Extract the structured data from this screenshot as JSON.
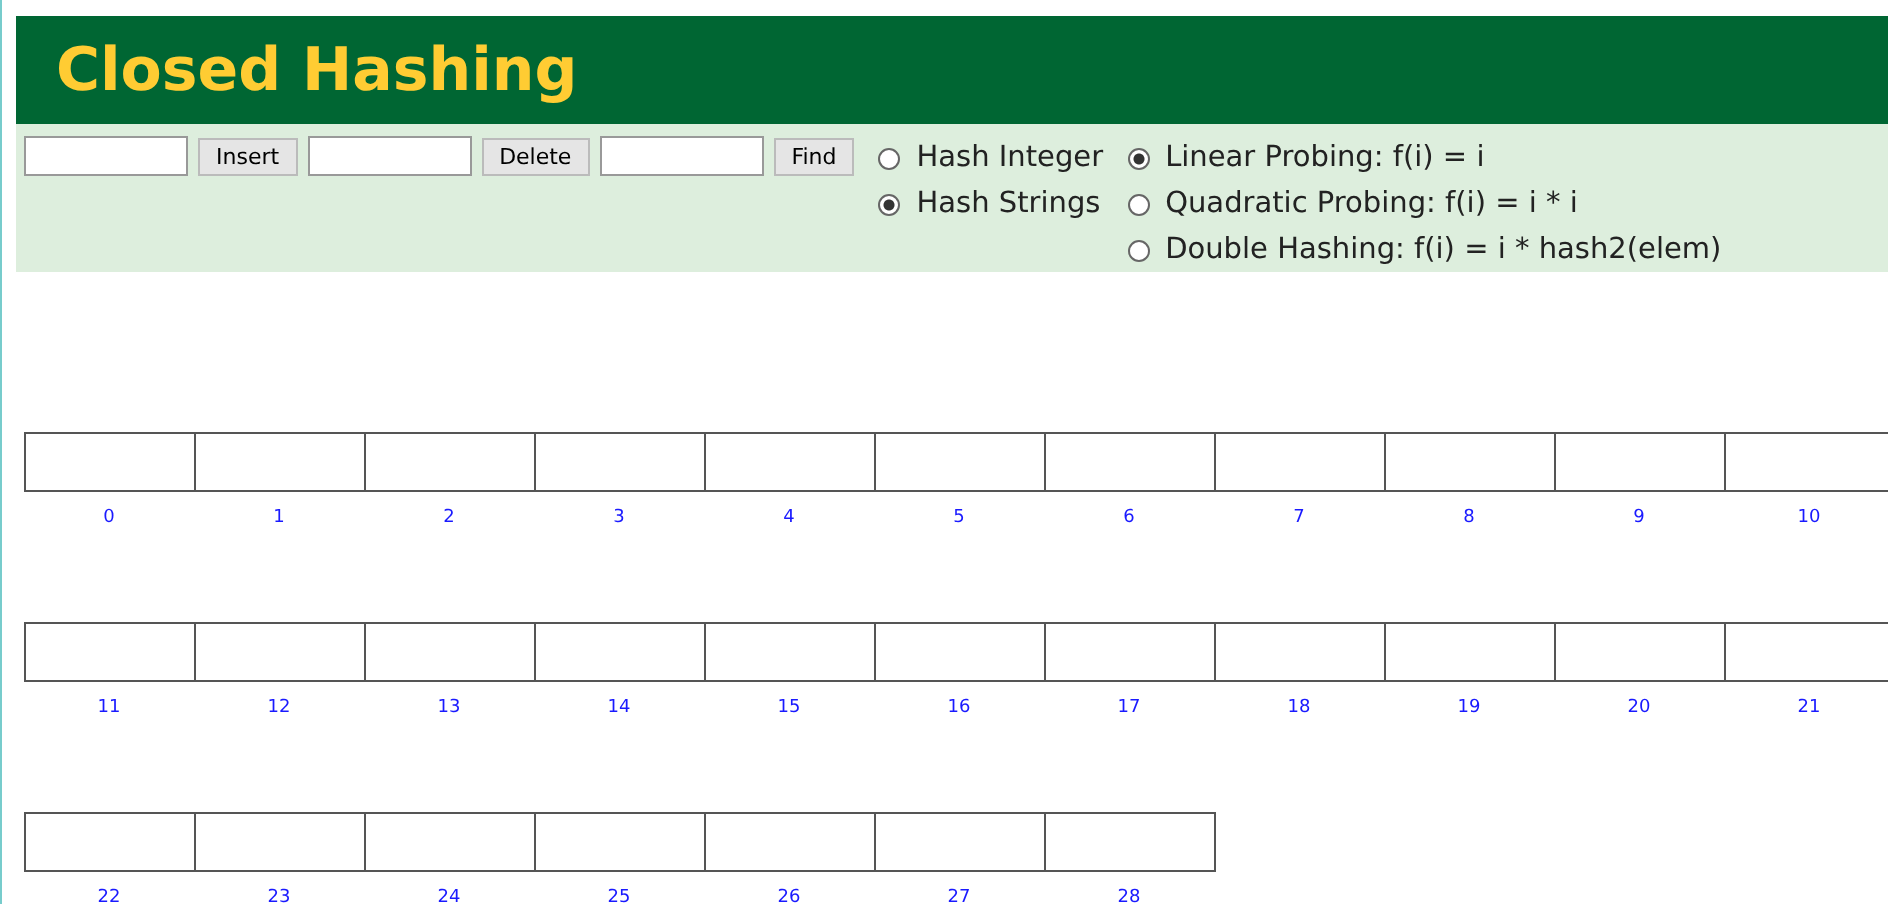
{
  "title": "Closed Hashing",
  "actions": [
    {
      "button": "Insert"
    },
    {
      "button": "Delete"
    },
    {
      "button": "Find"
    }
  ],
  "hash_type": [
    {
      "label": "Hash Integer",
      "selected": false
    },
    {
      "label": "Hash Strings",
      "selected": true
    }
  ],
  "probing": [
    {
      "label": "Linear Probing: f(i) = i",
      "selected": true
    },
    {
      "label": "Quadratic Probing: f(i) = i * i",
      "selected": false
    },
    {
      "label": "Double Hashing: f(i) = i * hash2(elem)",
      "selected": false
    }
  ],
  "table_rows": [
    {
      "slots": [
        "0",
        "1",
        "2",
        "3",
        "4",
        "5",
        "6",
        "7",
        "8",
        "9",
        "10"
      ]
    },
    {
      "slots": [
        "11",
        "12",
        "13",
        "14",
        "15",
        "16",
        "17",
        "18",
        "19",
        "20",
        "21"
      ]
    },
    {
      "slots": [
        "22",
        "23",
        "24",
        "25",
        "26",
        "27",
        "28"
      ]
    }
  ]
}
